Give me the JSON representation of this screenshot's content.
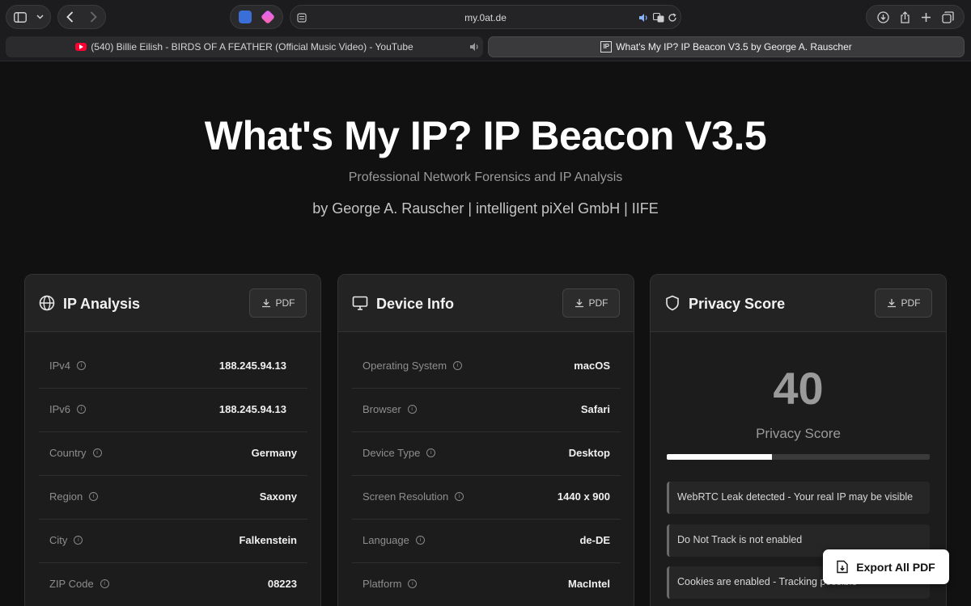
{
  "browser": {
    "url": "my.0at.de",
    "tabs": [
      {
        "label": "(540) Billie Eilish - BIRDS OF A FEATHER (Official Music Video) - YouTube",
        "active": false
      },
      {
        "label": "What's My IP? IP Beacon V3.5 by George A. Rauscher",
        "active": true
      }
    ]
  },
  "hero": {
    "title": "What's My IP? IP Beacon V3.5",
    "subtitle": "Professional Network Forensics and IP Analysis",
    "byline": "by George A. Rauscher | intelligent piXel GmbH | IIFE"
  },
  "cards": {
    "ip": {
      "title": "IP Analysis",
      "pdf_label": "PDF",
      "rows": [
        {
          "label": "IPv4",
          "value": "188.245.94.13"
        },
        {
          "label": "IPv6",
          "value": "188.245.94.13"
        },
        {
          "label": "Country",
          "value": "Germany"
        },
        {
          "label": "Region",
          "value": "Saxony"
        },
        {
          "label": "City",
          "value": "Falkenstein"
        },
        {
          "label": "ZIP Code",
          "value": "08223"
        }
      ]
    },
    "device": {
      "title": "Device Info",
      "pdf_label": "PDF",
      "rows": [
        {
          "label": "Operating System",
          "value": "macOS"
        },
        {
          "label": "Browser",
          "value": "Safari"
        },
        {
          "label": "Device Type",
          "value": "Desktop"
        },
        {
          "label": "Screen Resolution",
          "value": "1440 x 900"
        },
        {
          "label": "Language",
          "value": "de-DE"
        },
        {
          "label": "Platform",
          "value": "MacIntel"
        }
      ]
    },
    "privacy": {
      "title": "Privacy Score",
      "pdf_label": "PDF",
      "score": "40",
      "score_label": "Privacy Score",
      "score_fraction": 0.4,
      "warnings": [
        "WebRTC Leak detected - Your real IP may be visible",
        "Do Not Track is not enabled",
        "Cookies are enabled - Tracking possible"
      ]
    }
  },
  "export": {
    "label": "Export All PDF"
  },
  "icons": {
    "ip": "globe-icon",
    "device": "monitor-icon",
    "privacy": "shield-icon",
    "pdf": "download-icon",
    "info": "info-icon"
  }
}
